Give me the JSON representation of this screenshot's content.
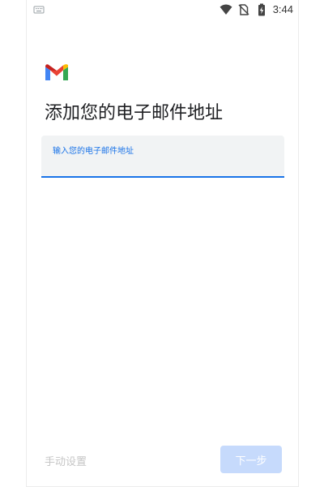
{
  "status_bar": {
    "time": "3:44",
    "left_icon": "keyboard-icon",
    "right_icons": [
      "wifi-icon",
      "no-sim-icon",
      "battery-charging-icon"
    ]
  },
  "header": {
    "logo": "gmail-logo",
    "title": "添加您的电子邮件地址"
  },
  "email_field": {
    "label": "输入您的电子邮件地址",
    "value": ""
  },
  "footer": {
    "manual_setup_label": "手动设置",
    "next_label": "下一步"
  },
  "colors": {
    "accent": "#1a73e8",
    "field_background": "#f1f3f4",
    "next_button_disabled": "#c6dafc",
    "manual_setup_disabled": "#c6c6c6",
    "title_text": "#202124"
  }
}
